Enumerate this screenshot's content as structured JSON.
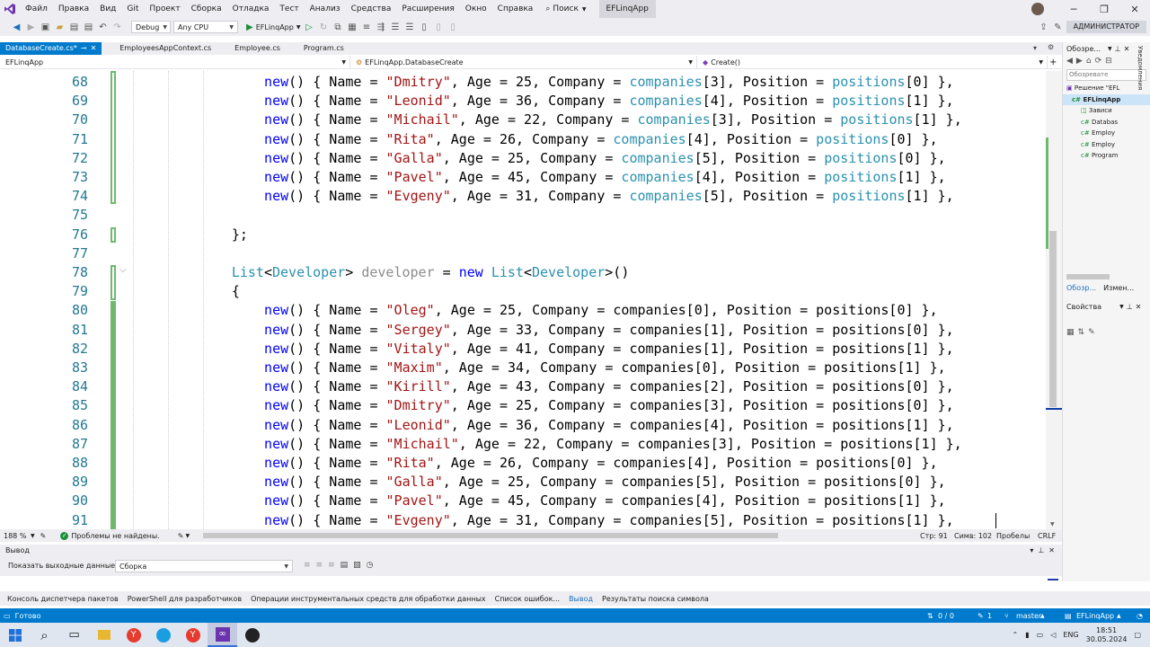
{
  "menu": {
    "items": [
      "Файл",
      "Правка",
      "Вид",
      "Git",
      "Проект",
      "Сборка",
      "Отладка",
      "Тест",
      "Анализ",
      "Средства",
      "Расширения",
      "Окно",
      "Справка"
    ],
    "search_label": "Поиск",
    "project_title": "EFLinqApp"
  },
  "toolbar": {
    "config": "Debug",
    "platform": "Any CPU",
    "run_label": "EFLinqApp",
    "admin_label": "АДМИНИСТРАТОР"
  },
  "tabs": [
    {
      "label": "DatabaseCreate.cs*",
      "active": true
    },
    {
      "label": "EmployeesAppContext.cs",
      "active": false
    },
    {
      "label": "Employee.cs",
      "active": false
    },
    {
      "label": "Program.cs",
      "active": false
    }
  ],
  "nav": {
    "project": "EFLinqApp",
    "class": "EFLinqApp.DatabaseCreate",
    "member": "Create()"
  },
  "code": {
    "employees": [
      {
        "ln": 68,
        "name": "Dmitry",
        "age": 25,
        "company": 3,
        "position": 0
      },
      {
        "ln": 69,
        "name": "Leonid",
        "age": 36,
        "company": 4,
        "position": 1
      },
      {
        "ln": 70,
        "name": "Michail",
        "age": 22,
        "company": 3,
        "position": 1
      },
      {
        "ln": 71,
        "name": "Rita",
        "age": 26,
        "company": 4,
        "position": 0
      },
      {
        "ln": 72,
        "name": "Galla",
        "age": 25,
        "company": 5,
        "position": 0
      },
      {
        "ln": 73,
        "name": "Pavel",
        "age": 45,
        "company": 4,
        "position": 1
      },
      {
        "ln": 74,
        "name": "Evgeny",
        "age": 31,
        "company": 5,
        "position": 1
      }
    ],
    "declaration": {
      "ln": 78,
      "type": "List",
      "generic": "Developer",
      "var": "developer"
    },
    "developers": [
      {
        "ln": 80,
        "name": "Oleg",
        "age": 25,
        "company": 0,
        "position": 0
      },
      {
        "ln": 81,
        "name": "Sergey",
        "age": 33,
        "company": 1,
        "position": 0
      },
      {
        "ln": 82,
        "name": "Vitaly",
        "age": 41,
        "company": 1,
        "position": 1
      },
      {
        "ln": 83,
        "name": "Maxim",
        "age": 34,
        "company": 0,
        "position": 1
      },
      {
        "ln": 84,
        "name": "Kirill",
        "age": 43,
        "company": 2,
        "position": 0
      },
      {
        "ln": 85,
        "name": "Dmitry",
        "age": 25,
        "company": 3,
        "position": 0
      },
      {
        "ln": 86,
        "name": "Leonid",
        "age": 36,
        "company": 4,
        "position": 1
      },
      {
        "ln": 87,
        "name": "Michail",
        "age": 22,
        "company": 3,
        "position": 1
      },
      {
        "ln": 88,
        "name": "Rita",
        "age": 26,
        "company": 4,
        "position": 0
      },
      {
        "ln": 89,
        "name": "Galla",
        "age": 25,
        "company": 5,
        "position": 0
      },
      {
        "ln": 90,
        "name": "Pavel",
        "age": 45,
        "company": 4,
        "position": 1
      },
      {
        "ln": 91,
        "name": "Evgeny",
        "age": 31,
        "company": 5,
        "position": 1
      }
    ]
  },
  "editor_status": {
    "zoom": "188 %",
    "problems": "Проблемы не найдены.",
    "line": "Стр: 91",
    "col": "Симв: 102",
    "whitespace": "Пробелы",
    "eol": "CRLF"
  },
  "solution_explorer": {
    "title": "Обозре...",
    "search_placeholder": "Обозревате",
    "items": [
      "Решение \"EFL",
      "EFLinqApp",
      "Зависи",
      "Databas",
      "Employ",
      "Employ",
      "Program"
    ],
    "tabs": [
      "Обозр...",
      "Измен..."
    ],
    "properties_title": "Свойства",
    "vertical_label": "Уведомления"
  },
  "output": {
    "title": "Вывод",
    "show_label": "Показать выходные данные из:",
    "source": "Сборка"
  },
  "bottom_tabs": [
    "Консоль диспетчера пакетов",
    "PowerShell для разработчиков",
    "Операции инструментальных средств для обработки данных",
    "Список ошибок...",
    "Вывод",
    "Результаты поиска символа"
  ],
  "statusbar": {
    "ready": "Готово",
    "errors": "0 / 0",
    "changes": "1",
    "branch": "master",
    "project": "EFLinqApp"
  },
  "taskbar": {
    "lang": "ENG",
    "time": "18:51",
    "date": "30.05.2024"
  }
}
